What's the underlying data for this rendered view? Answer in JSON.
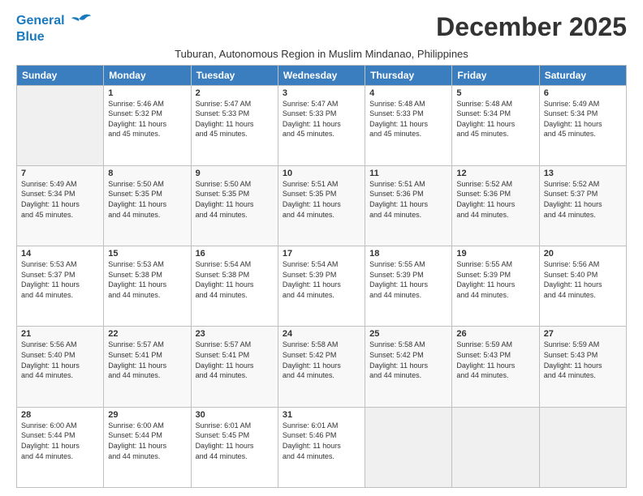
{
  "header": {
    "logo_line1": "General",
    "logo_line2": "Blue",
    "month_year": "December 2025",
    "subtitle": "Tuburan, Autonomous Region in Muslim Mindanao, Philippines"
  },
  "weekdays": [
    "Sunday",
    "Monday",
    "Tuesday",
    "Wednesday",
    "Thursday",
    "Friday",
    "Saturday"
  ],
  "weeks": [
    [
      {
        "day": "",
        "info": ""
      },
      {
        "day": "1",
        "info": "Sunrise: 5:46 AM\nSunset: 5:32 PM\nDaylight: 11 hours\nand 45 minutes."
      },
      {
        "day": "2",
        "info": "Sunrise: 5:47 AM\nSunset: 5:33 PM\nDaylight: 11 hours\nand 45 minutes."
      },
      {
        "day": "3",
        "info": "Sunrise: 5:47 AM\nSunset: 5:33 PM\nDaylight: 11 hours\nand 45 minutes."
      },
      {
        "day": "4",
        "info": "Sunrise: 5:48 AM\nSunset: 5:33 PM\nDaylight: 11 hours\nand 45 minutes."
      },
      {
        "day": "5",
        "info": "Sunrise: 5:48 AM\nSunset: 5:34 PM\nDaylight: 11 hours\nand 45 minutes."
      },
      {
        "day": "6",
        "info": "Sunrise: 5:49 AM\nSunset: 5:34 PM\nDaylight: 11 hours\nand 45 minutes."
      }
    ],
    [
      {
        "day": "7",
        "info": "Sunrise: 5:49 AM\nSunset: 5:34 PM\nDaylight: 11 hours\nand 45 minutes."
      },
      {
        "day": "8",
        "info": "Sunrise: 5:50 AM\nSunset: 5:35 PM\nDaylight: 11 hours\nand 44 minutes."
      },
      {
        "day": "9",
        "info": "Sunrise: 5:50 AM\nSunset: 5:35 PM\nDaylight: 11 hours\nand 44 minutes."
      },
      {
        "day": "10",
        "info": "Sunrise: 5:51 AM\nSunset: 5:35 PM\nDaylight: 11 hours\nand 44 minutes."
      },
      {
        "day": "11",
        "info": "Sunrise: 5:51 AM\nSunset: 5:36 PM\nDaylight: 11 hours\nand 44 minutes."
      },
      {
        "day": "12",
        "info": "Sunrise: 5:52 AM\nSunset: 5:36 PM\nDaylight: 11 hours\nand 44 minutes."
      },
      {
        "day": "13",
        "info": "Sunrise: 5:52 AM\nSunset: 5:37 PM\nDaylight: 11 hours\nand 44 minutes."
      }
    ],
    [
      {
        "day": "14",
        "info": "Sunrise: 5:53 AM\nSunset: 5:37 PM\nDaylight: 11 hours\nand 44 minutes."
      },
      {
        "day": "15",
        "info": "Sunrise: 5:53 AM\nSunset: 5:38 PM\nDaylight: 11 hours\nand 44 minutes."
      },
      {
        "day": "16",
        "info": "Sunrise: 5:54 AM\nSunset: 5:38 PM\nDaylight: 11 hours\nand 44 minutes."
      },
      {
        "day": "17",
        "info": "Sunrise: 5:54 AM\nSunset: 5:39 PM\nDaylight: 11 hours\nand 44 minutes."
      },
      {
        "day": "18",
        "info": "Sunrise: 5:55 AM\nSunset: 5:39 PM\nDaylight: 11 hours\nand 44 minutes."
      },
      {
        "day": "19",
        "info": "Sunrise: 5:55 AM\nSunset: 5:39 PM\nDaylight: 11 hours\nand 44 minutes."
      },
      {
        "day": "20",
        "info": "Sunrise: 5:56 AM\nSunset: 5:40 PM\nDaylight: 11 hours\nand 44 minutes."
      }
    ],
    [
      {
        "day": "21",
        "info": "Sunrise: 5:56 AM\nSunset: 5:40 PM\nDaylight: 11 hours\nand 44 minutes."
      },
      {
        "day": "22",
        "info": "Sunrise: 5:57 AM\nSunset: 5:41 PM\nDaylight: 11 hours\nand 44 minutes."
      },
      {
        "day": "23",
        "info": "Sunrise: 5:57 AM\nSunset: 5:41 PM\nDaylight: 11 hours\nand 44 minutes."
      },
      {
        "day": "24",
        "info": "Sunrise: 5:58 AM\nSunset: 5:42 PM\nDaylight: 11 hours\nand 44 minutes."
      },
      {
        "day": "25",
        "info": "Sunrise: 5:58 AM\nSunset: 5:42 PM\nDaylight: 11 hours\nand 44 minutes."
      },
      {
        "day": "26",
        "info": "Sunrise: 5:59 AM\nSunset: 5:43 PM\nDaylight: 11 hours\nand 44 minutes."
      },
      {
        "day": "27",
        "info": "Sunrise: 5:59 AM\nSunset: 5:43 PM\nDaylight: 11 hours\nand 44 minutes."
      }
    ],
    [
      {
        "day": "28",
        "info": "Sunrise: 6:00 AM\nSunset: 5:44 PM\nDaylight: 11 hours\nand 44 minutes."
      },
      {
        "day": "29",
        "info": "Sunrise: 6:00 AM\nSunset: 5:44 PM\nDaylight: 11 hours\nand 44 minutes."
      },
      {
        "day": "30",
        "info": "Sunrise: 6:01 AM\nSunset: 5:45 PM\nDaylight: 11 hours\nand 44 minutes."
      },
      {
        "day": "31",
        "info": "Sunrise: 6:01 AM\nSunset: 5:46 PM\nDaylight: 11 hours\nand 44 minutes."
      },
      {
        "day": "",
        "info": ""
      },
      {
        "day": "",
        "info": ""
      },
      {
        "day": "",
        "info": ""
      }
    ]
  ]
}
